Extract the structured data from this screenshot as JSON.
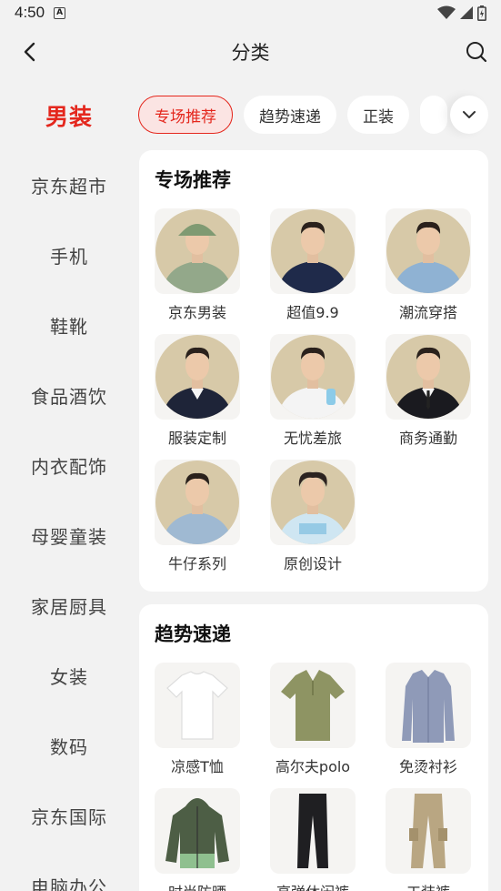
{
  "status": {
    "time": "4:50",
    "badge": "A"
  },
  "header": {
    "title": "分类"
  },
  "sidebar": {
    "items": [
      {
        "label": "男装",
        "active": true
      },
      {
        "label": "京东超市"
      },
      {
        "label": "手机"
      },
      {
        "label": "鞋靴"
      },
      {
        "label": "食品酒饮"
      },
      {
        "label": "内衣配饰"
      },
      {
        "label": "母婴童装"
      },
      {
        "label": "家居厨具"
      },
      {
        "label": "女装"
      },
      {
        "label": "数码"
      },
      {
        "label": "京东国际"
      },
      {
        "label": "电脑办公"
      }
    ]
  },
  "tabs": [
    {
      "label": "专场推荐",
      "active": true
    },
    {
      "label": "趋势速递"
    },
    {
      "label": "正装"
    }
  ],
  "sections": [
    {
      "title": "专场推荐",
      "items": [
        {
          "label": "京东男装",
          "icon": "man-green-polo-bucket-hat"
        },
        {
          "label": "超值9.9",
          "icon": "man-navy-polo"
        },
        {
          "label": "潮流穿搭",
          "icon": "man-denim-jacket"
        },
        {
          "label": "服装定制",
          "icon": "man-dark-suit"
        },
        {
          "label": "无忧差旅",
          "icon": "man-white-tee"
        },
        {
          "label": "商务通勤",
          "icon": "man-black-suit-tie"
        },
        {
          "label": "牛仔系列",
          "icon": "man-denim-shirt"
        },
        {
          "label": "原创设计",
          "icon": "man-graphic-sweatshirt"
        }
      ]
    },
    {
      "title": "趋势速递",
      "items": [
        {
          "label": "凉感T恤",
          "icon": "white-tshirt"
        },
        {
          "label": "高尔夫polo",
          "icon": "olive-polo-shirt"
        },
        {
          "label": "免烫衬衫",
          "icon": "blue-dress-shirt"
        },
        {
          "label": "时尚防晒",
          "icon": "green-hooded-jacket"
        },
        {
          "label": "高弹休闲裤",
          "icon": "black-trousers"
        },
        {
          "label": "工装裤",
          "icon": "khaki-cargo-pants"
        }
      ]
    }
  ],
  "colors": {
    "accent": "#e4271d",
    "accent_bg": "#fbe4e3",
    "page_bg": "#f2f2f2",
    "portrait_bg": "#d7c9a8"
  }
}
